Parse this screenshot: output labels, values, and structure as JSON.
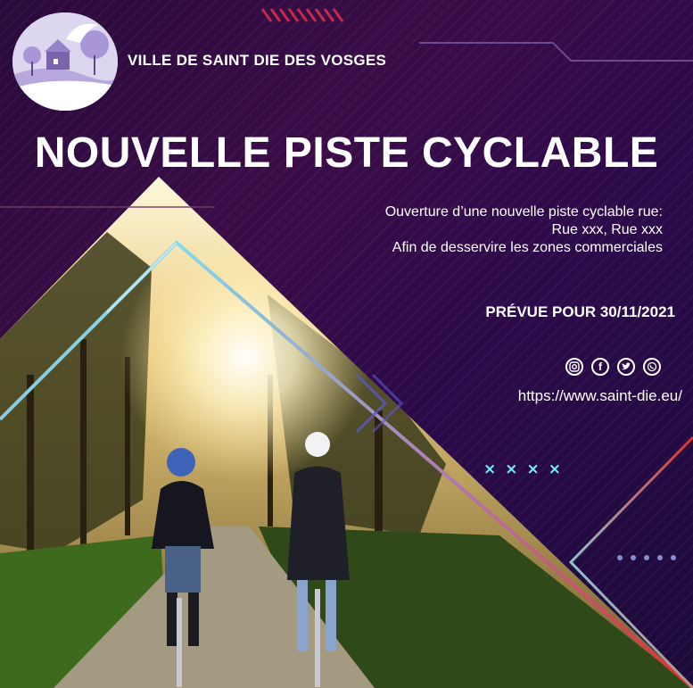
{
  "header": {
    "city_name": "VILLE DE SAINT DIE DES VOSGES"
  },
  "main": {
    "title": "NOUVELLE PISTE CYCLABLE",
    "description_lines": [
      "Ouverture d’une nouvelle piste cyclable rue:",
      "Rue xxx, Rue xxx",
      "Afin de desservire les zones commerciales"
    ],
    "date_text": "PRÉVUE POUR 30/11/2021"
  },
  "footer": {
    "social_icons": [
      "instagram-icon",
      "facebook-icon",
      "twitter-icon",
      "whatsapp-icon"
    ],
    "url": "https://www.saint-die.eu/"
  },
  "decor": {
    "crosses": [
      "×",
      "×",
      "×",
      "×"
    ]
  },
  "colors": {
    "background": "#2a0a3c",
    "accent_cyan": "#6ff0ff",
    "accent_red": "#e0302c"
  }
}
